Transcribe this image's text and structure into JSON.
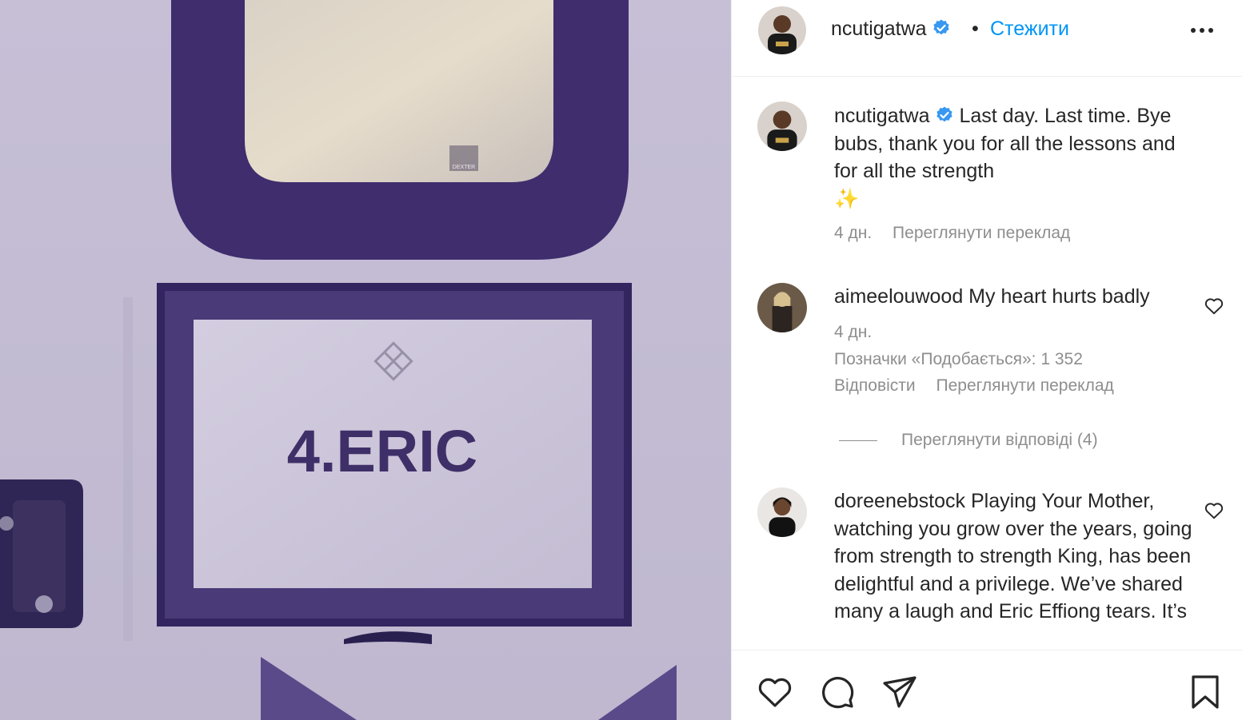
{
  "photo": {
    "sign_text": "4.ERIC",
    "mirror_label": "DEXTER"
  },
  "header": {
    "username": "ncutigatwa",
    "separator": "•",
    "follow_label": "Стежити"
  },
  "caption": {
    "author": "ncutigatwa",
    "text": "Last day. Last time. Bye bubs, thank you for all the lessons and for all the strength",
    "emoji": "✨",
    "time": "4 дн.",
    "translate": "Переглянути переклад"
  },
  "comments": [
    {
      "author": "aimeelouwood",
      "text": "My heart hurts badly",
      "time": "4 дн.",
      "likes": "Позначки «Подобається»: 1 352",
      "reply": "Відповісти",
      "translate": "Переглянути переклад",
      "view_replies": "Переглянути відповіді (4)"
    },
    {
      "author": "doreenebstock",
      "text": "Playing Your Mother, watching you grow over the years, going from strength to strength King, has been delightful and a privilege. We’ve shared many a laugh and Eric Effiong tears. It’s"
    }
  ],
  "colors": {
    "accent": "#0095f6",
    "verified": "#3897f0",
    "muted": "#8e8e8e",
    "frame": "#3b2a6e"
  },
  "icons": [
    "verified-icon",
    "more-options-icon",
    "heart-icon",
    "comment-icon",
    "share-icon",
    "bookmark-icon"
  ]
}
